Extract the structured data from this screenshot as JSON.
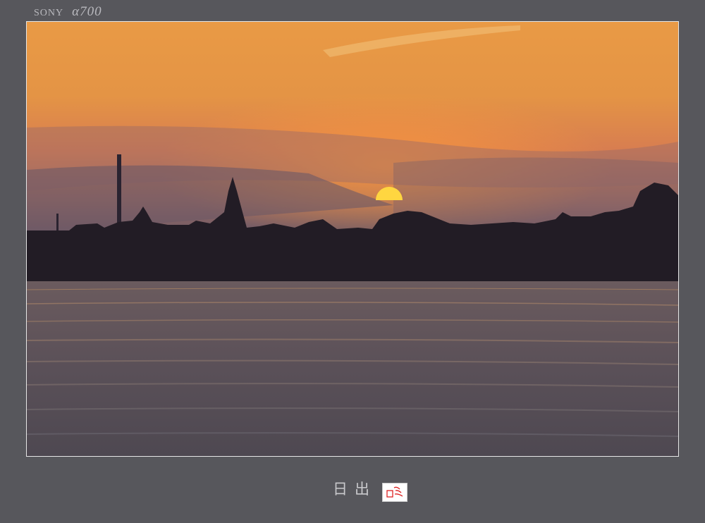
{
  "camera": {
    "brand": "SONY",
    "model": "α700"
  },
  "caption": "日出",
  "colors": {
    "background": "#57575c",
    "sky_top": "#e6933d",
    "sky_bottom": "#8f6567",
    "sun": "#ffd23a",
    "water": "#4f4a52"
  },
  "seal": {
    "description_icon": "red-seal-stamp-icon"
  }
}
